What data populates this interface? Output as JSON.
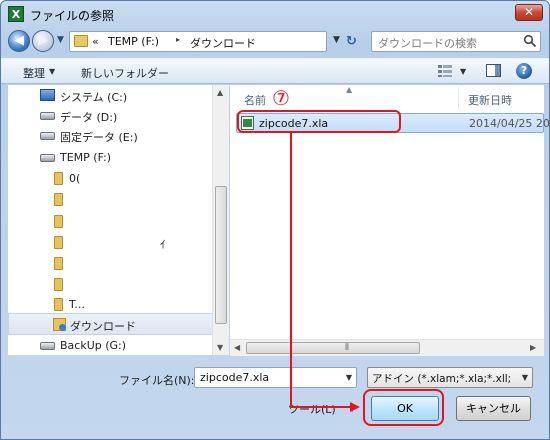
{
  "window": {
    "title": "ファイルの参照",
    "app_icon_letter": "X",
    "close_glyph": "✕"
  },
  "nav": {
    "back_glyph": "◀",
    "forward_glyph": "▶",
    "address": {
      "overflow": "«",
      "segments": [
        "TEMP (F:)",
        "ダウンロード"
      ],
      "separator": "▸"
    },
    "refresh_glyph": "↻",
    "search_placeholder": "ダウンロードの検索"
  },
  "toolbar": {
    "organize_label": "整理",
    "new_folder_label": "新しいフォルダー",
    "help_glyph": "?"
  },
  "sidebar": {
    "items": [
      {
        "label": "システム (C:)",
        "icon": "system-drive-icon"
      },
      {
        "label": "データ (D:)",
        "icon": "drive-icon"
      },
      {
        "label": "固定データ (E:)",
        "icon": "drive-icon"
      },
      {
        "label": "TEMP (F:)",
        "icon": "drive-icon"
      },
      {
        "label": "0(",
        "icon": "folder-icon"
      },
      {
        "label": "",
        "icon": "folder-icon"
      },
      {
        "label": "",
        "icon": "folder-icon"
      },
      {
        "label": "ｲ",
        "icon": "folder-icon"
      },
      {
        "label": "",
        "icon": "folder-icon"
      },
      {
        "label": "",
        "icon": "folder-icon"
      },
      {
        "label": "T...",
        "icon": "folder-icon"
      },
      {
        "label": "ダウンロード",
        "icon": "download-folder-icon",
        "selected": true
      },
      {
        "label": "BackUp (G:)",
        "icon": "drive-icon"
      }
    ]
  },
  "file_list": {
    "columns": {
      "name": "名前",
      "date": "更新日時"
    },
    "rows": [
      {
        "name": "zipcode7.xla",
        "date": "2014/04/25 20:"
      }
    ]
  },
  "footer": {
    "filename_label": "ファイル名(N):",
    "filename_value": "zipcode7.xla",
    "filter_value": "アドイン (*.xlam;*.xla;*.xll;",
    "tools_label": "ツール(L)",
    "ok_label": "OK",
    "cancel_label": "キャンセル"
  },
  "annotation": {
    "step_number": "⑦",
    "color": "#e8141c"
  }
}
